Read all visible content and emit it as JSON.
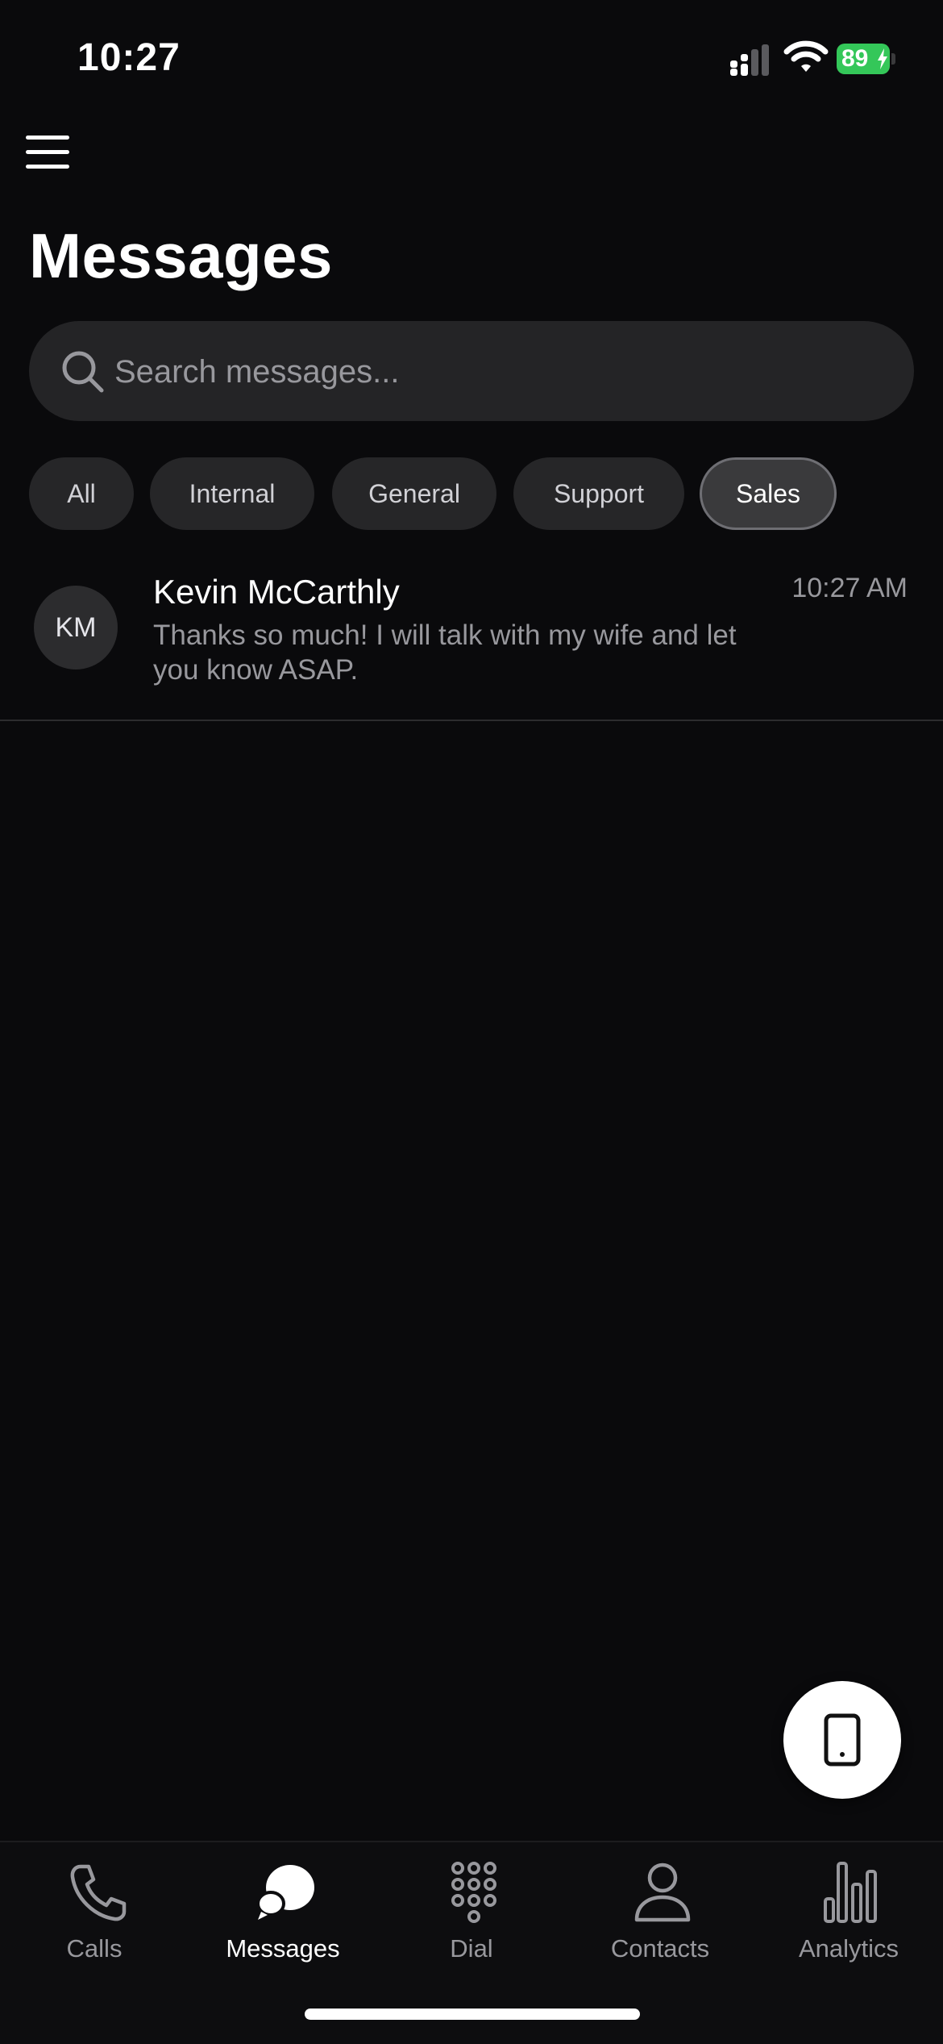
{
  "status_bar": {
    "time": "10:27",
    "battery_level": "89",
    "battery_color": "#34c759"
  },
  "header": {
    "title": "Messages",
    "menu_icon": "hamburger-menu-icon"
  },
  "search": {
    "placeholder": "Search messages...",
    "value": "",
    "icon": "search-icon"
  },
  "filters": {
    "selected": "Sales",
    "items": [
      {
        "label": "All"
      },
      {
        "label": "Internal"
      },
      {
        "label": "General"
      },
      {
        "label": "Support"
      },
      {
        "label": "Sales"
      }
    ]
  },
  "conversations": [
    {
      "initials": "KM",
      "name": "Kevin McCarthly",
      "preview": "Thanks so much! I will talk with my wife and let you know ASAP.",
      "time": "10:27 AM"
    }
  ],
  "fab": {
    "icon": "phone-device-icon"
  },
  "tabs": {
    "selected": "Messages",
    "items": [
      {
        "label": "Calls",
        "icon": "phone-icon"
      },
      {
        "label": "Messages",
        "icon": "chat-bubbles-icon"
      },
      {
        "label": "Dial",
        "icon": "dialpad-icon"
      },
      {
        "label": "Contacts",
        "icon": "person-icon"
      },
      {
        "label": "Analytics",
        "icon": "bar-chart-icon"
      }
    ]
  }
}
